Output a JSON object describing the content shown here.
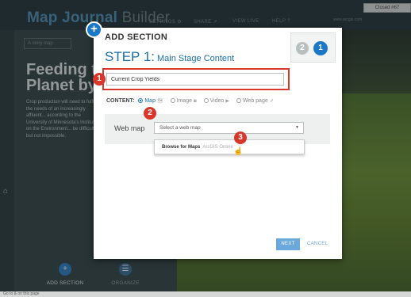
{
  "app": {
    "title_main": "Map Journal",
    "title_light": " Builder",
    "menu": [
      "SETTINGS ⚙",
      "SHARE ⇗",
      "VIEW LIVE",
      "HELP ?"
    ],
    "closed_tag": "Closed #67",
    "right_note": "www.arcgis.com"
  },
  "side": {
    "story_tab": "A story map",
    "heading": "Feeding the Planet by",
    "body": "Crop production will need to fulfill the needs of an increasingly affluent... according to the University of Minnesota's Institute on the Environment... be difficult but not impossible.",
    "add_section": "ADD SECTION",
    "organize": "ORGANIZE"
  },
  "status": "Go to & on this page",
  "dialog": {
    "title": "ADD SECTION",
    "step_label": "STEP 1:",
    "step_sub": "Main Stage Content",
    "steps": [
      "2",
      "1"
    ],
    "title_input_value": "Current Crop Yields",
    "content_label": "CONTENT:",
    "options": [
      {
        "label": "Map",
        "icon": "map-icon",
        "glyph": "🗺"
      },
      {
        "label": "Image",
        "icon": "image-icon",
        "glyph": "◙"
      },
      {
        "label": "Video",
        "icon": "video-icon",
        "glyph": "▶"
      },
      {
        "label": "Web page",
        "icon": "external-link-icon",
        "glyph": "⇗"
      }
    ],
    "webmap_label": "Web map",
    "select_placeholder": "Select a web map",
    "dropdown_browse": "Browse for Maps",
    "dropdown_source": "ArcGIS Online",
    "next": "NEXT",
    "cancel": "CANCEL"
  },
  "badges": [
    "1",
    "2",
    "3"
  ],
  "colors": {
    "accent": "#1b78c8",
    "highlight": "#d9362c",
    "next_button": "#6ba9dc"
  }
}
